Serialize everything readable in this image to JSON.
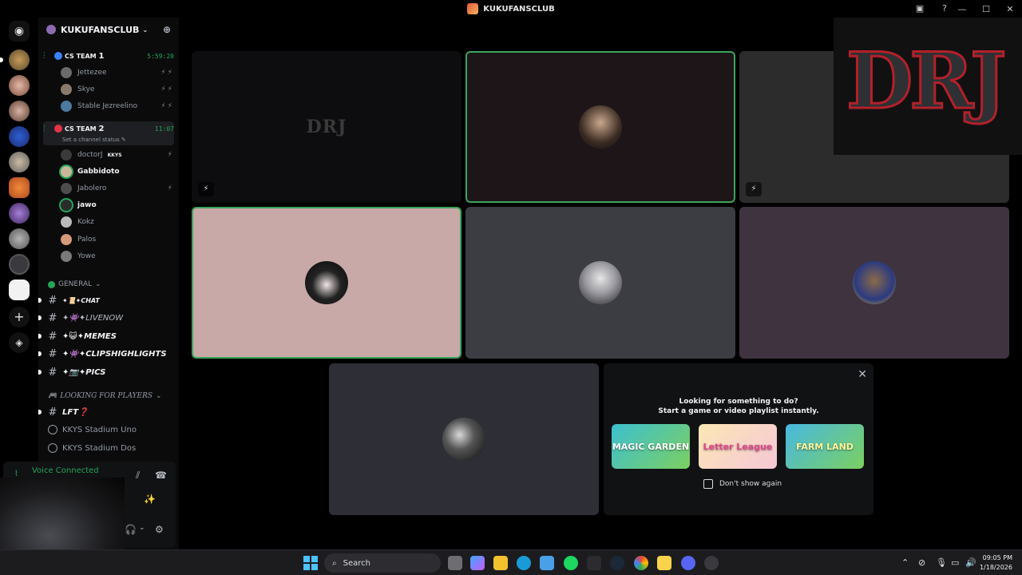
{
  "window": {
    "title": "KUKUFANSCLUB"
  },
  "guild": {
    "name": "KUKUFANSCLUB"
  },
  "voice_channels": [
    {
      "name": "CS TEAM",
      "number": "1",
      "timer": "5:59:20",
      "color": "#3b82f6",
      "members": [
        {
          "name": "Jettezee",
          "bright": false
        },
        {
          "name": "Skye",
          "bright": false
        },
        {
          "name": "Stable Jezreelino",
          "bright": false
        }
      ]
    },
    {
      "name": "CS TEAM",
      "number": "2",
      "timer": "11:07",
      "color": "#e5334a",
      "status": "Set a channel status",
      "members": [
        {
          "name": "doctorJ",
          "tag": "KKYS",
          "bright": false
        },
        {
          "name": "Gabbidoto",
          "bright": true
        },
        {
          "name": "Jabolero",
          "bright": false
        },
        {
          "name": "jawo",
          "bright": true
        },
        {
          "name": "Kokz",
          "bright": false
        },
        {
          "name": "Palos",
          "bright": false
        },
        {
          "name": "Yowe",
          "bright": false
        }
      ]
    }
  ],
  "categories": {
    "general": "GENERAL",
    "lfp": "LOOKING FOR PLAYERS"
  },
  "text_channels": [
    {
      "label": "✦📜✦CHAT"
    },
    {
      "label": "✦👾✦LIVENOW"
    },
    {
      "label": "✦😺✦MEMES"
    },
    {
      "label": "✦👾✦CLIPSHIGHLIGHTS"
    },
    {
      "label": "✦📷✦PICS"
    },
    {
      "label": "LFT❓"
    }
  ],
  "stage_channels": [
    "KKYS Stadium Uno",
    "KKYS Stadium Dos"
  ],
  "voice_panel": {
    "status": "Voice Connected"
  },
  "tiles": [
    {
      "kind": "logo",
      "logo_text": "DRJ"
    },
    {
      "kind": "avatar",
      "speaking": true
    },
    {
      "kind": "blank"
    },
    {
      "kind": "avatar",
      "speaking": true
    },
    {
      "kind": "avatar",
      "speaking": false
    },
    {
      "kind": "avatar",
      "speaking": false
    },
    {
      "kind": "avatar",
      "speaking": false
    }
  ],
  "stream_overlay": {
    "logo_text": "DRJ"
  },
  "activity": {
    "line1": "Looking for something to do?",
    "line2": "Start a game or video playlist instantly.",
    "games": [
      {
        "name": "MAGIC GARDEN",
        "bg": "#4dbfb0"
      },
      {
        "name": "Letter League",
        "bg": "#f7e1a6"
      },
      {
        "name": "FARM LAND",
        "bg": "#5cc36b"
      }
    ],
    "dont_show": "Don't show again"
  },
  "taskbar": {
    "search_placeholder": "Search",
    "time": "09:05 PM",
    "date": "1/18/2026"
  }
}
